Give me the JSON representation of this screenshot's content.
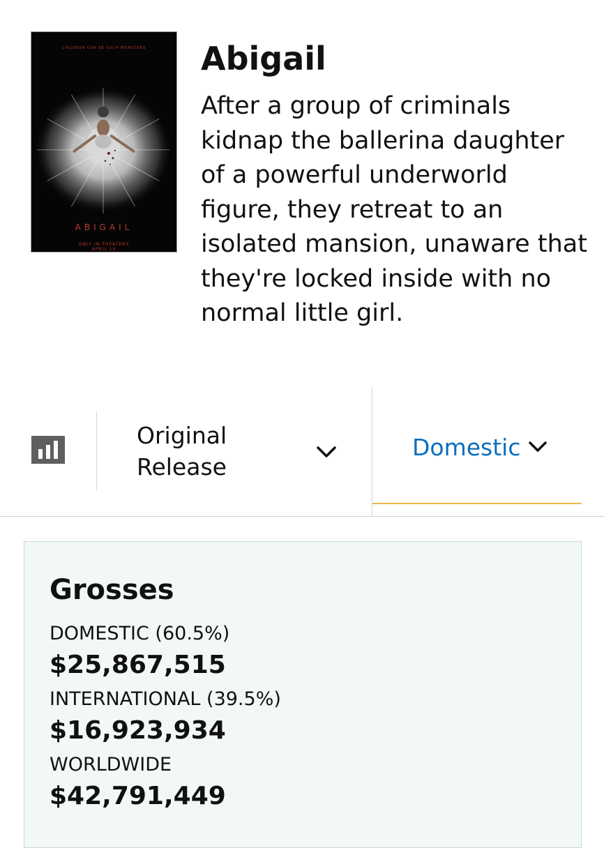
{
  "movie": {
    "title": "Abigail",
    "synopsis": "After a group of criminals kidnap the ballerina daughter of a powerful underworld figure, they retreat to an isolated mansion, unaware that they're locked inside with no normal little girl.",
    "poster": {
      "tagline": "CHILDREN CAN BE SUCH MONSTERS",
      "title": "ABIGAIL",
      "release_line_1": "ONLY IN THEATERS",
      "release_line_2": "APRIL 19"
    }
  },
  "filters": {
    "chart_icon": "bar-chart-icon",
    "release": {
      "label": "Original Release",
      "icon": "chevron-down-icon"
    },
    "region": {
      "label": "Domestic",
      "icon": "chevron-down-icon"
    }
  },
  "grosses": {
    "heading": "Grosses",
    "domestic": {
      "label": "DOMESTIC (60.5%)",
      "value": "$25,867,515"
    },
    "international": {
      "label": "INTERNATIONAL (39.5%)",
      "value": "$16,923,934"
    },
    "worldwide": {
      "label": "WORLDWIDE",
      "value": "$42,791,449"
    }
  },
  "colors": {
    "link_blue": "#0a6ebd",
    "tab_underline": "#e8b84a",
    "panel_background": "#f2f7f7",
    "poster_accent": "#c0392b"
  }
}
